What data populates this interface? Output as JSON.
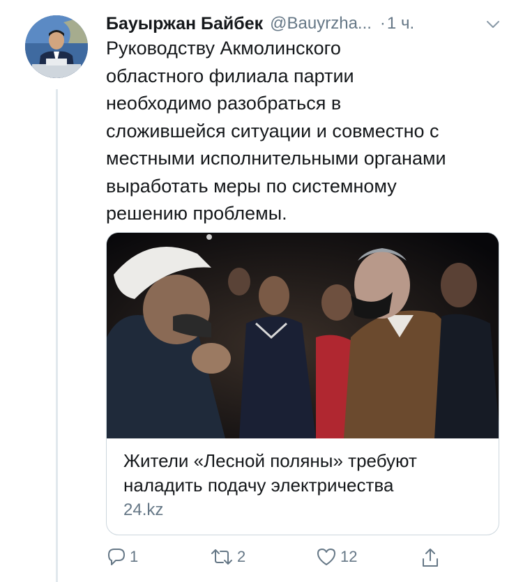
{
  "tweet": {
    "author_name": "Бауыржан Байбек",
    "handle": "@Bauyrzha...",
    "separator": "·",
    "time": "1 ч.",
    "text_lines": [
      "Руководству Акмолинского",
      "областного филиала партии",
      "необходимо разобраться в",
      "сложившейся ситуации и совместно с",
      "местными исполнительными органами",
      "выработать меры по системному",
      "решению проблемы."
    ]
  },
  "card": {
    "title_lines": [
      "Жители «Лесной поляны» требуют",
      "наладить подачу электричества"
    ],
    "domain": "24.kz"
  },
  "actions": {
    "reply_count": "1",
    "retweet_count": "2",
    "like_count": "12"
  },
  "icons": {
    "caret": "chevron-down-icon",
    "reply": "reply-icon",
    "retweet": "retweet-icon",
    "like": "heart-icon",
    "share": "share-icon"
  },
  "colors": {
    "text": "#14171a",
    "secondary": "#657786",
    "border": "#ccd6dd"
  }
}
